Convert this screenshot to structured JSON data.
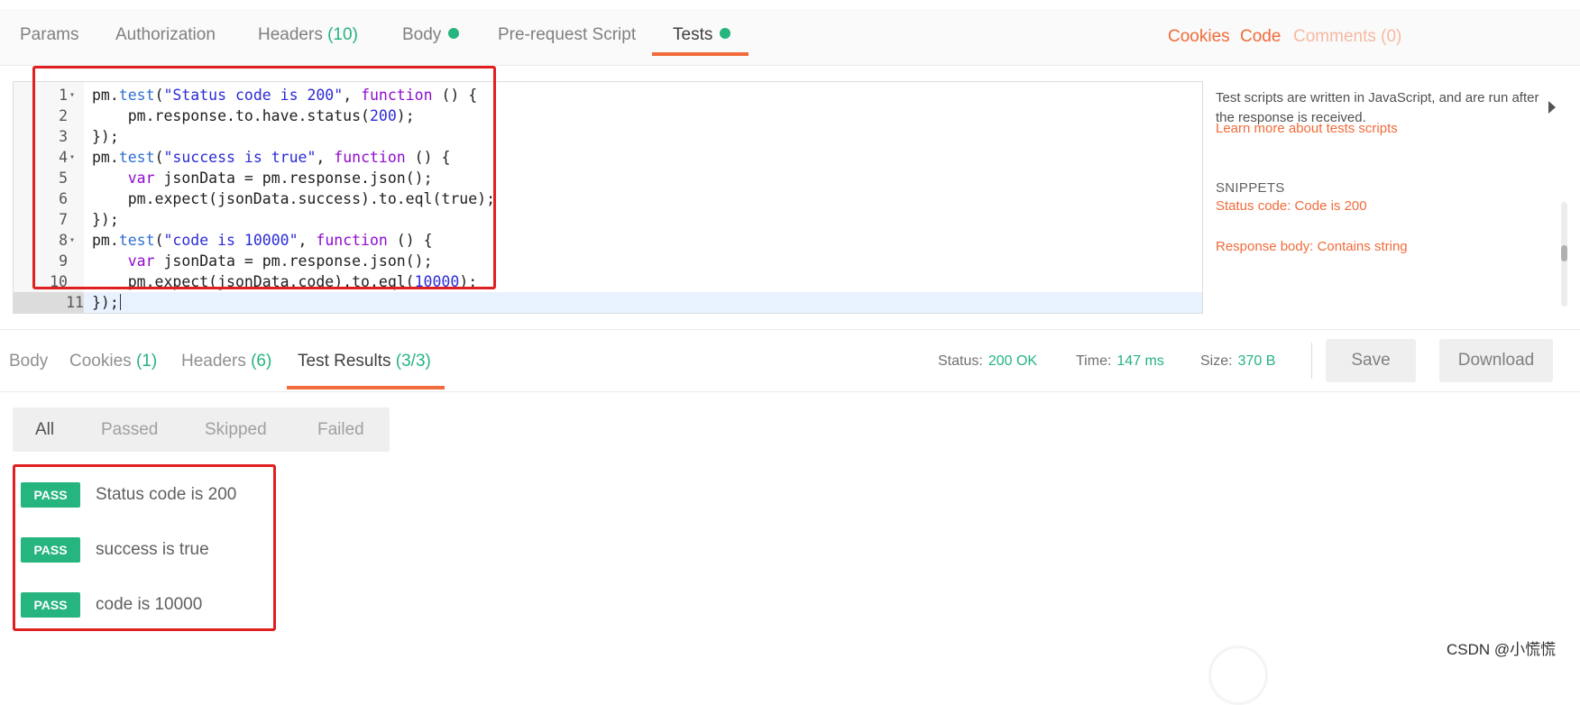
{
  "request_tabs": {
    "params": "Params",
    "authorization": "Authorization",
    "headers": "Headers",
    "headers_count": "(10)",
    "body": "Body",
    "prerequest": "Pre-request Script",
    "tests": "Tests"
  },
  "top_links": {
    "cookies": "Cookies",
    "code": "Code",
    "comments": "Comments (0)"
  },
  "editor": {
    "line_numbers": [
      "1",
      "2",
      "3",
      "4",
      "5",
      "6",
      "7",
      "8",
      "9",
      "10",
      "11"
    ],
    "lines": [
      [
        [
          "",
          "pm."
        ],
        [
          "mth",
          "test"
        ],
        [
          "",
          "("
        ],
        [
          "str",
          "\"Status code is 200\""
        ],
        [
          "",
          ", "
        ],
        [
          "kw",
          "function"
        ],
        [
          "",
          " () {"
        ]
      ],
      [
        [
          "",
          "    pm.response.to.have.status("
        ],
        [
          "num",
          "200"
        ],
        [
          "",
          ");"
        ]
      ],
      [
        [
          "",
          "});"
        ]
      ],
      [
        [
          "",
          "pm."
        ],
        [
          "mth",
          "test"
        ],
        [
          "",
          "("
        ],
        [
          "str",
          "\"success is true\""
        ],
        [
          "",
          ", "
        ],
        [
          "kw",
          "function"
        ],
        [
          "",
          " () {"
        ]
      ],
      [
        [
          "",
          "    "
        ],
        [
          "kw",
          "var"
        ],
        [
          "",
          " jsonData = pm.response.json();"
        ]
      ],
      [
        [
          "",
          "    pm.expect(jsonData.success).to.eql(true);"
        ]
      ],
      [
        [
          "",
          "});"
        ]
      ],
      [
        [
          "",
          "pm."
        ],
        [
          "mth",
          "test"
        ],
        [
          "",
          "("
        ],
        [
          "str",
          "\"code is 10000\""
        ],
        [
          "",
          ", "
        ],
        [
          "kw",
          "function"
        ],
        [
          "",
          " () {"
        ]
      ],
      [
        [
          "",
          "    "
        ],
        [
          "kw",
          "var"
        ],
        [
          "",
          " jsonData = pm.response.json();"
        ]
      ],
      [
        [
          "",
          "    pm.expect(jsonData.code).to.eql("
        ],
        [
          "num",
          "10000"
        ],
        [
          "",
          ");"
        ]
      ],
      [
        [
          "",
          "});"
        ]
      ]
    ]
  },
  "help": {
    "description": "Test scripts are written in JavaScript, and are run after the response is received.",
    "learn_more": "Learn more about tests scripts",
    "snippets_heading": "SNIPPETS",
    "snippets": [
      "Status code: Code is 200",
      "Response body: Contains string"
    ]
  },
  "response_tabs": {
    "body": "Body",
    "cookies": "Cookies",
    "cookies_count": "(1)",
    "headers": "Headers",
    "headers_count": "(6)",
    "test_results": "Test Results",
    "test_results_count": "(3/3)"
  },
  "status": {
    "status_label": "Status:",
    "status_value": "200 OK",
    "time_label": "Time:",
    "time_value": "147 ms",
    "size_label": "Size:",
    "size_value": "370 B"
  },
  "buttons": {
    "save": "Save",
    "download": "Download"
  },
  "filters": {
    "all": "All",
    "passed": "Passed",
    "skipped": "Skipped",
    "failed": "Failed",
    "selected": "All"
  },
  "results": [
    {
      "badge": "PASS",
      "name": "Status code is 200"
    },
    {
      "badge": "PASS",
      "name": "success is true"
    },
    {
      "badge": "PASS",
      "name": "code is 10000"
    }
  ],
  "watermark": "CSDN @小慌慌",
  "colors": {
    "accent": "#f26b3a",
    "success": "#26b47f",
    "highlight_box": "#e02020"
  }
}
